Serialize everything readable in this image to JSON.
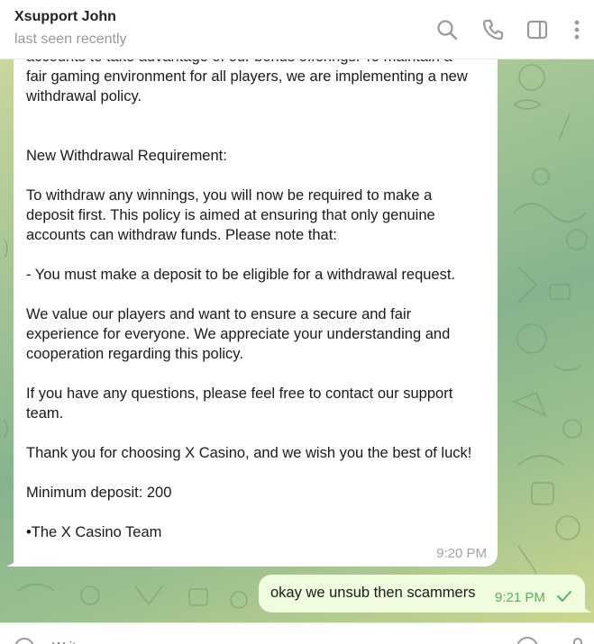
{
  "header": {
    "name": "Xsupport John",
    "status": "last seen recently",
    "icons": [
      "search-icon",
      "phone-icon",
      "sidebar-toggle-icon",
      "more-vertical-icon"
    ]
  },
  "messages": {
    "incoming": {
      "text": "accounts to take advantage of our bonus offerings. To maintain a\nfair gaming environment for all players, we are implementing a new\nwithdrawal policy.\n\n\nNew Withdrawal Requirement:\n\nTo withdraw any winnings, you will now be required to make a\ndeposit first. This policy is aimed at ensuring that only genuine\naccounts can withdraw funds. Please note that:\n\n- You must make a deposit to be eligible for a withdrawal request.\n\nWe value our players and want to ensure a secure and fair\nexperience for everyone. We appreciate your understanding and\ncooperation regarding this policy.\n\nIf you have any questions, please feel free to contact our support\nteam.\n\nThank you for choosing X Casino, and we wish you the best of luck!\n\nMinimum deposit: 200\n\n•The X Casino Team",
      "time": "9:20 PM"
    },
    "outgoing": {
      "text": "okay we unsub then scammers",
      "time": "9:21 PM",
      "status_icon": "read-check-icon"
    }
  },
  "composer": {
    "placeholder": "Write a message..."
  },
  "colors": {
    "outgoing_bubble": "#effdde",
    "outgoing_time": "#5eaf5a",
    "incoming_bubble": "#ffffff"
  }
}
